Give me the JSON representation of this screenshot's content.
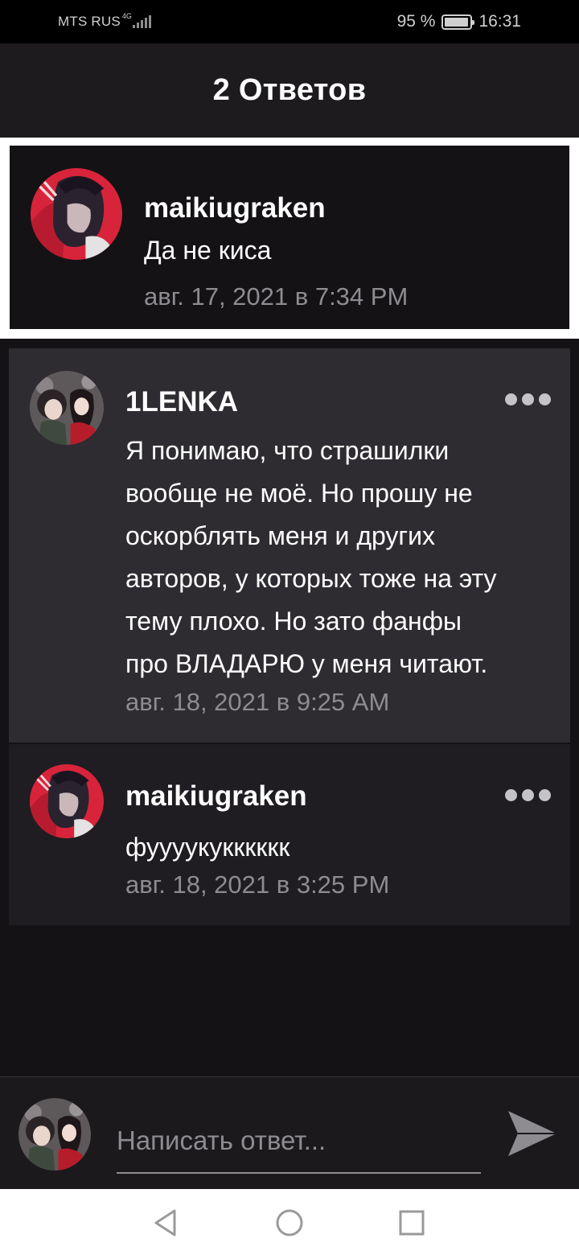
{
  "status_bar": {
    "carrier": "MTS RUS",
    "network": "4G",
    "battery_text": "95 %",
    "battery_level": 0.95,
    "time": "16:31"
  },
  "header": {
    "title": "2 Ответов"
  },
  "parent_comment": {
    "username": "maikiugraken",
    "text": "Да не киса",
    "timestamp": "авг. 17, 2021 в 7:34 PM"
  },
  "replies": [
    {
      "username": "1LENKA",
      "text_lines": [
        "Я понимаю, что страшилки",
        "вообще не моё. Но прошу не",
        "оскорблять меня и других",
        "авторов, у которых тоже на эту",
        "тему плохо. Но зато фанфы",
        "про ВЛАДАРЮ у меня читают."
      ],
      "timestamp": "авг. 18, 2021 в 9:25 AM"
    },
    {
      "username": "maikiugraken",
      "text": "фуууукукккккк",
      "timestamp": "авг. 18, 2021 в 3:25 PM"
    }
  ],
  "compose": {
    "placeholder": "Написать ответ..."
  },
  "icons": {
    "more": "more-dots-icon",
    "send": "send-icon",
    "nav_back": "nav-back-icon",
    "nav_home": "nav-home-icon",
    "nav_recent": "nav-recent-icon"
  },
  "colors": {
    "background": "#141215",
    "header": "#1d1b1e",
    "reply_highlight": "#2e2c30",
    "reply": "#1f1d21",
    "muted_text": "#8e8c90",
    "accent_red": "#d8243a"
  }
}
